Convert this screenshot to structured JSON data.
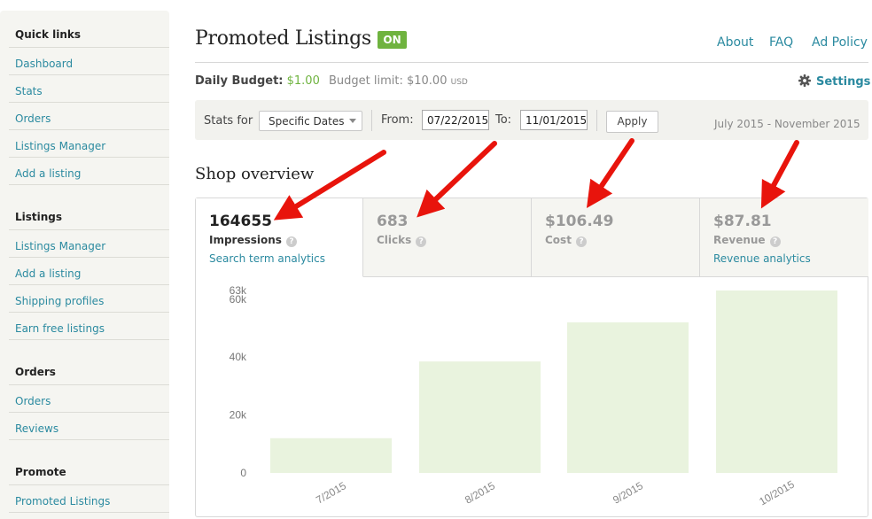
{
  "sidebar": {
    "sections": [
      {
        "heading": "Quick links",
        "items": [
          "Dashboard",
          "Stats",
          "Orders",
          "Listings Manager",
          "Add a listing"
        ]
      },
      {
        "heading": "Listings",
        "items": [
          "Listings Manager",
          "Add a listing",
          "Shipping profiles",
          "Earn free listings"
        ]
      },
      {
        "heading": "Orders",
        "items": [
          "Orders",
          "Reviews"
        ]
      },
      {
        "heading": "Promote",
        "items": [
          "Promoted Listings"
        ]
      }
    ]
  },
  "header": {
    "title": "Promoted Listings",
    "badge": "ON",
    "links": [
      "About",
      "FAQ",
      "Ad Policy"
    ]
  },
  "budget": {
    "label": "Daily Budget:",
    "value": "$1.00",
    "limit": "Budget limit: $10.00",
    "currency": "USD",
    "settings_label": "Settings"
  },
  "stats_bar": {
    "stats_for_label": "Stats for",
    "range_select": "Specific Dates",
    "from_label": "From:",
    "from_value": "07/22/2015",
    "to_label": "To:",
    "to_value": "11/01/2015",
    "apply_label": "Apply",
    "range_text": "July 2015 - November 2015"
  },
  "overview": {
    "title": "Shop overview",
    "tabs": [
      {
        "value": "164655",
        "label": "Impressions",
        "link": "Search term analytics",
        "active": true
      },
      {
        "value": "683",
        "label": "Clicks",
        "link": "",
        "active": false
      },
      {
        "value": "$106.49",
        "label": "Cost",
        "link": "",
        "active": false
      },
      {
        "value": "$87.81",
        "label": "Revenue",
        "link": "Revenue analytics",
        "active": false
      }
    ]
  },
  "colors": {
    "accent_link": "#2b8aa0",
    "badge_green": "#6fb33f",
    "bar_fill": "#e9f3de",
    "arrow_red": "#e8140c"
  },
  "chart_data": {
    "type": "bar",
    "categories": [
      "7/2015",
      "8/2015",
      "9/2015",
      "10/2015"
    ],
    "values": [
      12000,
      38500,
      52000,
      63000
    ],
    "y_ticks": [
      "0",
      "20k",
      "40k",
      "60k",
      "63k"
    ],
    "y_tick_values": [
      0,
      20000,
      40000,
      60000,
      63000
    ],
    "ylim": [
      0,
      63000
    ],
    "grid": false
  }
}
